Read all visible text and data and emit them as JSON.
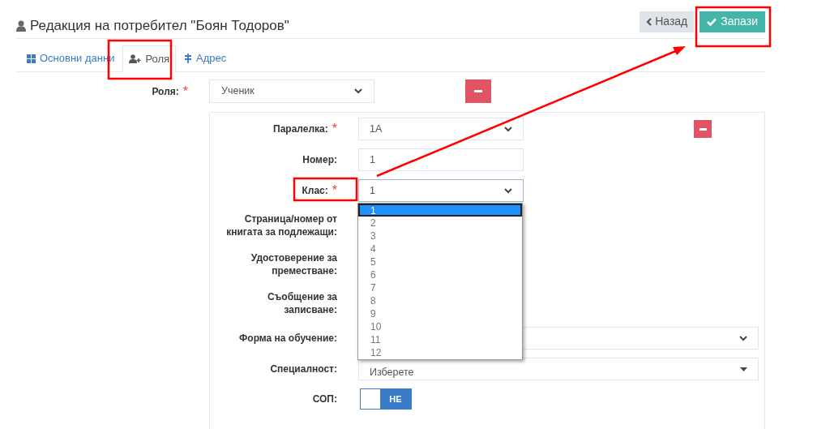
{
  "header": {
    "title": "Редакция на потребител \"Боян Тодоров\"",
    "buttons": [
      {
        "kind": "back",
        "label": "Назад"
      },
      {
        "kind": "save",
        "label": "Запази"
      }
    ]
  },
  "tabs": [
    {
      "label": "Основни данни",
      "selected": false
    },
    {
      "label": "Роля",
      "selected": true
    },
    {
      "label": "Адрес",
      "selected": false
    }
  ],
  "role": {
    "label": "Роля:",
    "required_mark": "*",
    "value": "Ученик"
  },
  "fields": [
    {
      "kind": "select",
      "label": "Паралелка:",
      "required_mark": "*",
      "value": "1А",
      "removable": true
    },
    {
      "kind": "input",
      "label": "Номер:",
      "value": "1"
    },
    {
      "kind": "select",
      "label": "Клас:",
      "required_mark": "*",
      "value": "1",
      "open": true
    },
    {
      "kind": "blank",
      "label": "Страница/номер от книгата за подлежащи:"
    },
    {
      "kind": "blank",
      "label": "Удостоверение за преместване:"
    },
    {
      "kind": "blank",
      "label": "Съобщение за записване:"
    },
    {
      "kind": "wide-select",
      "label": "Форма на обучение:"
    },
    {
      "kind": "wide-combo",
      "label": "Специалност:",
      "value": "Изберете"
    },
    {
      "kind": "toggle",
      "label": "СОП:",
      "on": false,
      "text": "НЕ"
    }
  ],
  "dropdown": {
    "options": [
      {
        "label": "1",
        "selected": true
      },
      {
        "label": "2",
        "selected": false
      },
      {
        "label": "3",
        "selected": false
      },
      {
        "label": "4",
        "selected": false
      },
      {
        "label": "5",
        "selected": false
      },
      {
        "label": "6",
        "selected": false
      },
      {
        "label": "7",
        "selected": false
      },
      {
        "label": "8",
        "selected": false
      },
      {
        "label": "9",
        "selected": false
      },
      {
        "label": "10",
        "selected": false
      },
      {
        "label": "11",
        "selected": false
      },
      {
        "label": "12",
        "selected": false
      }
    ]
  }
}
